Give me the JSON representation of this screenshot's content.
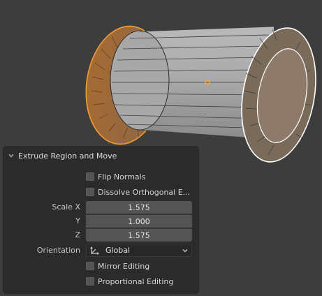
{
  "panel": {
    "title": "Extrude Region and Move",
    "flip_normals": {
      "label": "Flip Normals",
      "checked": false
    },
    "dissolve_orthogonal": {
      "label": "Dissolve Orthogonal E...",
      "checked": false
    },
    "scale": {
      "x_label": "Scale X",
      "x_value": "1.575",
      "y_label": "Y",
      "y_value": "1.000",
      "z_label": "Z",
      "z_value": "1.575"
    },
    "orientation": {
      "label": "Orientation",
      "value": "Global",
      "icon": "orientation-axes-icon"
    },
    "mirror_editing": {
      "label": "Mirror Editing",
      "checked": false
    },
    "proportional_editing": {
      "label": "Proportional Editing",
      "checked": false
    }
  },
  "viewport": {
    "object": "spool-mesh",
    "selected_face_color": "#f19a32",
    "origin_dot_color": "#ffa733",
    "background": "#3d3d3d"
  }
}
